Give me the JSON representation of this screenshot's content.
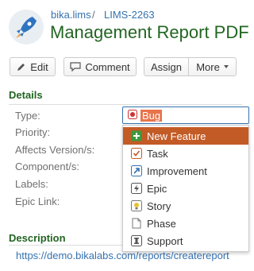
{
  "breadcrumb": {
    "project": "bika.lims",
    "separator": "/",
    "issue_key": "LIMS-2263"
  },
  "issue": {
    "title": "Management Report PDF"
  },
  "toolbar": {
    "edit": "Edit",
    "comment": "Comment",
    "assign": "Assign",
    "more": "More"
  },
  "details": {
    "heading": "Details",
    "fields": [
      "Type:",
      "Priority:",
      "Affects Version/s:",
      "Component/s:",
      "Labels:",
      "Epic Link:"
    ],
    "type_value": "Bug"
  },
  "type_options": [
    {
      "label": "New Feature",
      "icon": "new-feature-icon",
      "color": "#3c9a3c"
    },
    {
      "label": "Task",
      "icon": "task-icon",
      "color": "#c35b26"
    },
    {
      "label": "Improvement",
      "icon": "improvement-icon",
      "color": "#3572b0"
    },
    {
      "label": "Epic",
      "icon": "epic-icon",
      "color": "#555555"
    },
    {
      "label": "Story",
      "icon": "story-icon",
      "color": "#e9c233"
    },
    {
      "label": "Phase",
      "icon": "phase-icon",
      "color": "#777777"
    },
    {
      "label": "Support",
      "icon": "support-icon",
      "color": "#555555"
    }
  ],
  "description": {
    "heading": "Description",
    "text": "https://demo.bikalabs.com/reports/createreport"
  },
  "colors": {
    "heading_green": "#226522",
    "link_blue": "#3572b0",
    "highlight": "#c35b26"
  }
}
